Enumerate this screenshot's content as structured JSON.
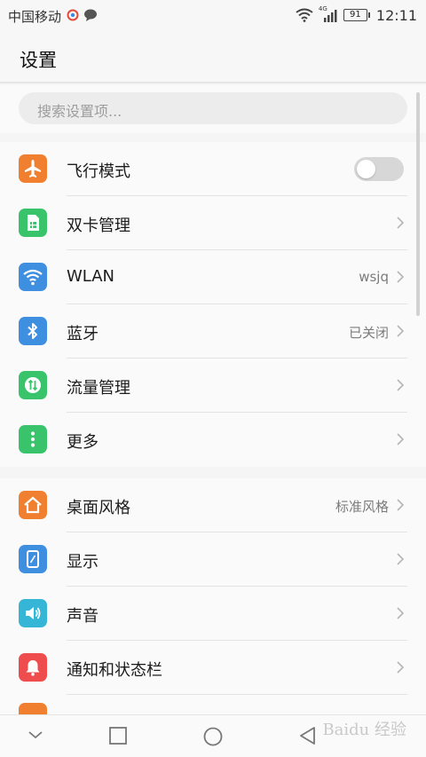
{
  "status_bar": {
    "carrier": "中国移动",
    "network": "4G",
    "battery": "91",
    "time": "12:11"
  },
  "header": {
    "title": "设置"
  },
  "search": {
    "placeholder": "搜索设置项..."
  },
  "groups": [
    {
      "items": [
        {
          "label": "飞行模式",
          "icon": "airplane-icon",
          "color": "#f07f2f",
          "control": "toggle",
          "on": false
        },
        {
          "label": "双卡管理",
          "icon": "sim-card-icon",
          "color": "#39c46b",
          "control": "chevron"
        },
        {
          "label": "WLAN",
          "icon": "wifi-icon",
          "color": "#3f8fe0",
          "value": "wsjq",
          "control": "chevron"
        },
        {
          "label": "蓝牙",
          "icon": "bluetooth-icon",
          "color": "#3f8fe0",
          "value": "已关闭",
          "control": "chevron"
        },
        {
          "label": "流量管理",
          "icon": "data-usage-icon",
          "color": "#39c46b",
          "control": "chevron"
        },
        {
          "label": "更多",
          "icon": "more-icon",
          "color": "#39c46b",
          "control": "chevron"
        }
      ]
    },
    {
      "items": [
        {
          "label": "桌面风格",
          "icon": "home-icon",
          "color": "#f07f2f",
          "value": "标准风格",
          "control": "chevron"
        },
        {
          "label": "显示",
          "icon": "display-icon",
          "color": "#3f8fe0",
          "control": "chevron"
        },
        {
          "label": "声音",
          "icon": "sound-icon",
          "color": "#35b6d6",
          "control": "chevron"
        },
        {
          "label": "通知和状态栏",
          "icon": "notification-bell-icon",
          "color": "#ef4d4d",
          "control": "chevron"
        }
      ]
    }
  ],
  "navigation": [
    "back-arrow",
    "home",
    "recent",
    "dropdown"
  ],
  "watermark": "Baidu 经验"
}
